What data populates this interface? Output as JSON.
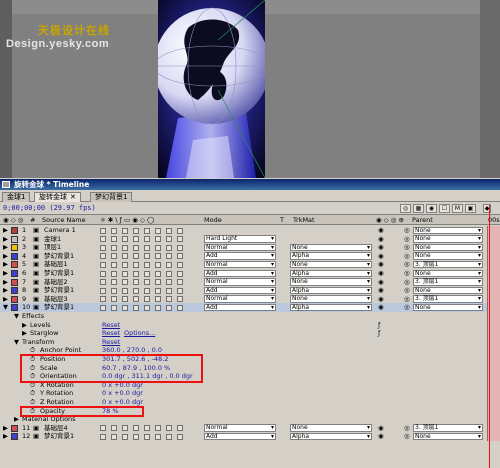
{
  "watermark": {
    "chinese": "天极设计在线",
    "url": "Design.yesky.com"
  },
  "timeline": {
    "window_title": "旋转金球 * Timeline",
    "tabs": [
      {
        "label": "金球1"
      },
      {
        "label": "旋转金球"
      },
      {
        "label": "梦幻背景1"
      }
    ],
    "timecode": "0;00;00;00",
    "fps": "(29.97 fps)",
    "columns": {
      "source_name": "Source Name",
      "mode": "Mode",
      "t": "T",
      "trkmat": "TrkMat",
      "parent": "Parent",
      "time_marker": "00s"
    },
    "layers": [
      {
        "num": "1",
        "name": "Camera 1",
        "color": "#b04040",
        "mode": "",
        "trkmat": "",
        "parent": "None"
      },
      {
        "num": "2",
        "name": "金球1",
        "color": "#c0c0c0",
        "mode": "Hard Light",
        "trkmat": "",
        "parent": "None"
      },
      {
        "num": "3",
        "name": "顶层1",
        "color": "#f0c000",
        "mode": "Normal",
        "trkmat": "None",
        "parent": "None"
      },
      {
        "num": "4",
        "name": "梦幻背景1",
        "color": "#4040d0",
        "mode": "Add",
        "trkmat": "Alpha",
        "parent": "None"
      },
      {
        "num": "5",
        "name": "基础层1",
        "color": "#d05050",
        "mode": "Normal",
        "trkmat": "None",
        "parent": "3. 顶层1"
      },
      {
        "num": "6",
        "name": "梦幻背景1",
        "color": "#4040d0",
        "mode": "Add",
        "trkmat": "Alpha",
        "parent": "None"
      },
      {
        "num": "7",
        "name": "基础层2",
        "color": "#d05050",
        "mode": "Normal",
        "trkmat": "None",
        "parent": "3. 顶层1"
      },
      {
        "num": "8",
        "name": "梦幻背景1",
        "color": "#4040d0",
        "mode": "Add",
        "trkmat": "Alpha",
        "parent": "None"
      },
      {
        "num": "9",
        "name": "基础层3",
        "color": "#d05050",
        "mode": "Normal",
        "trkmat": "None",
        "parent": "3. 顶层1"
      },
      {
        "num": "10",
        "name": "梦幻背景1",
        "color": "#4040d0",
        "mode": "Add",
        "trkmat": "Alpha",
        "parent": "None"
      }
    ],
    "effects": {
      "label": "Effects",
      "levels": {
        "name": "Levels",
        "value": "Reset"
      },
      "starglow": {
        "name": "Starglow",
        "value": "Reset",
        "options": "Options..."
      }
    },
    "transform": {
      "label": "Transform",
      "reset": "Reset",
      "properties": [
        {
          "name": "Anchor Point",
          "value": "360.0 , 270.0 , 0.0"
        },
        {
          "name": "Position",
          "value": "301.7 , 502.6 , -48.2"
        },
        {
          "name": "Scale",
          "value": "60.7 , 87.9 , 100.0 %"
        },
        {
          "name": "Orientation",
          "value": "0.0 dgr , 311.1 dgr , 0.0 dgr"
        },
        {
          "name": "X Rotation",
          "value": "0 x +0.0 dgr"
        },
        {
          "name": "Y Rotation",
          "value": "0 x +0.0 dgr"
        },
        {
          "name": "Z Rotation",
          "value": "0 x +0.0 dgr"
        },
        {
          "name": "Opacity",
          "value": "78 %"
        }
      ]
    },
    "material_options": "Material Options",
    "bottom_layers": [
      {
        "num": "11",
        "name": "基础层4",
        "color": "#d05050",
        "mode": "Normal",
        "trkmat": "None",
        "parent": "3. 顶层1"
      },
      {
        "num": "12",
        "name": "梦幻背景1",
        "color": "#4040d0",
        "mode": "Add",
        "trkmat": "Alpha",
        "parent": "None"
      }
    ]
  }
}
